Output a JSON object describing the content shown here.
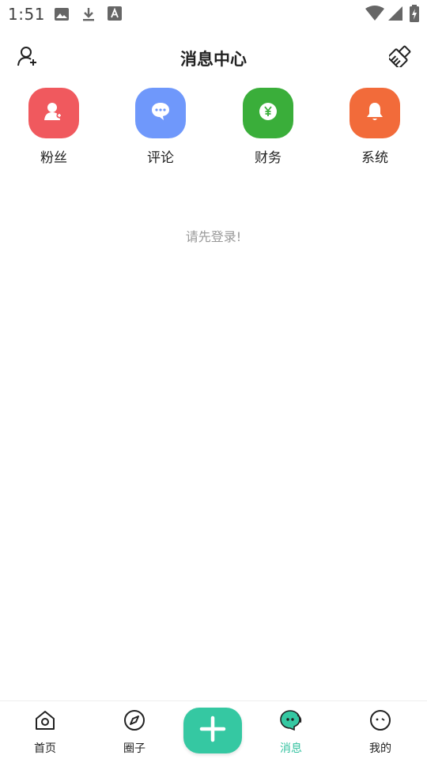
{
  "status_bar": {
    "time": "1:51",
    "icons": [
      "image-icon",
      "download-icon",
      "font-icon",
      "wifi-icon",
      "signal-icon",
      "battery-charging-icon"
    ]
  },
  "header": {
    "title": "消息中心",
    "left_icon": "add-user-icon",
    "right_icon": "clean-brush-icon"
  },
  "categories": [
    {
      "label": "粉丝",
      "icon": "fan-user-icon",
      "color": "#f0595e"
    },
    {
      "label": "评论",
      "icon": "comment-icon",
      "color": "#6f98fb"
    },
    {
      "label": "财务",
      "icon": "yuan-coin-icon",
      "color": "#3aae3a"
    },
    {
      "label": "系统",
      "icon": "bell-icon",
      "color": "#f26b3a"
    }
  ],
  "empty_message": "请先登录!",
  "bottom_nav": {
    "items": [
      {
        "label": "首页",
        "icon": "home-icon",
        "active": false
      },
      {
        "label": "圈子",
        "icon": "compass-icon",
        "active": false
      },
      {
        "label": "消息",
        "icon": "message-icon",
        "active": true
      },
      {
        "label": "我的",
        "icon": "profile-face-icon",
        "active": false
      }
    ],
    "fab_icon": "plus-icon"
  },
  "colors": {
    "accent": "#35c8a2",
    "active_text": "#35c2a0",
    "muted_text": "#999999"
  }
}
